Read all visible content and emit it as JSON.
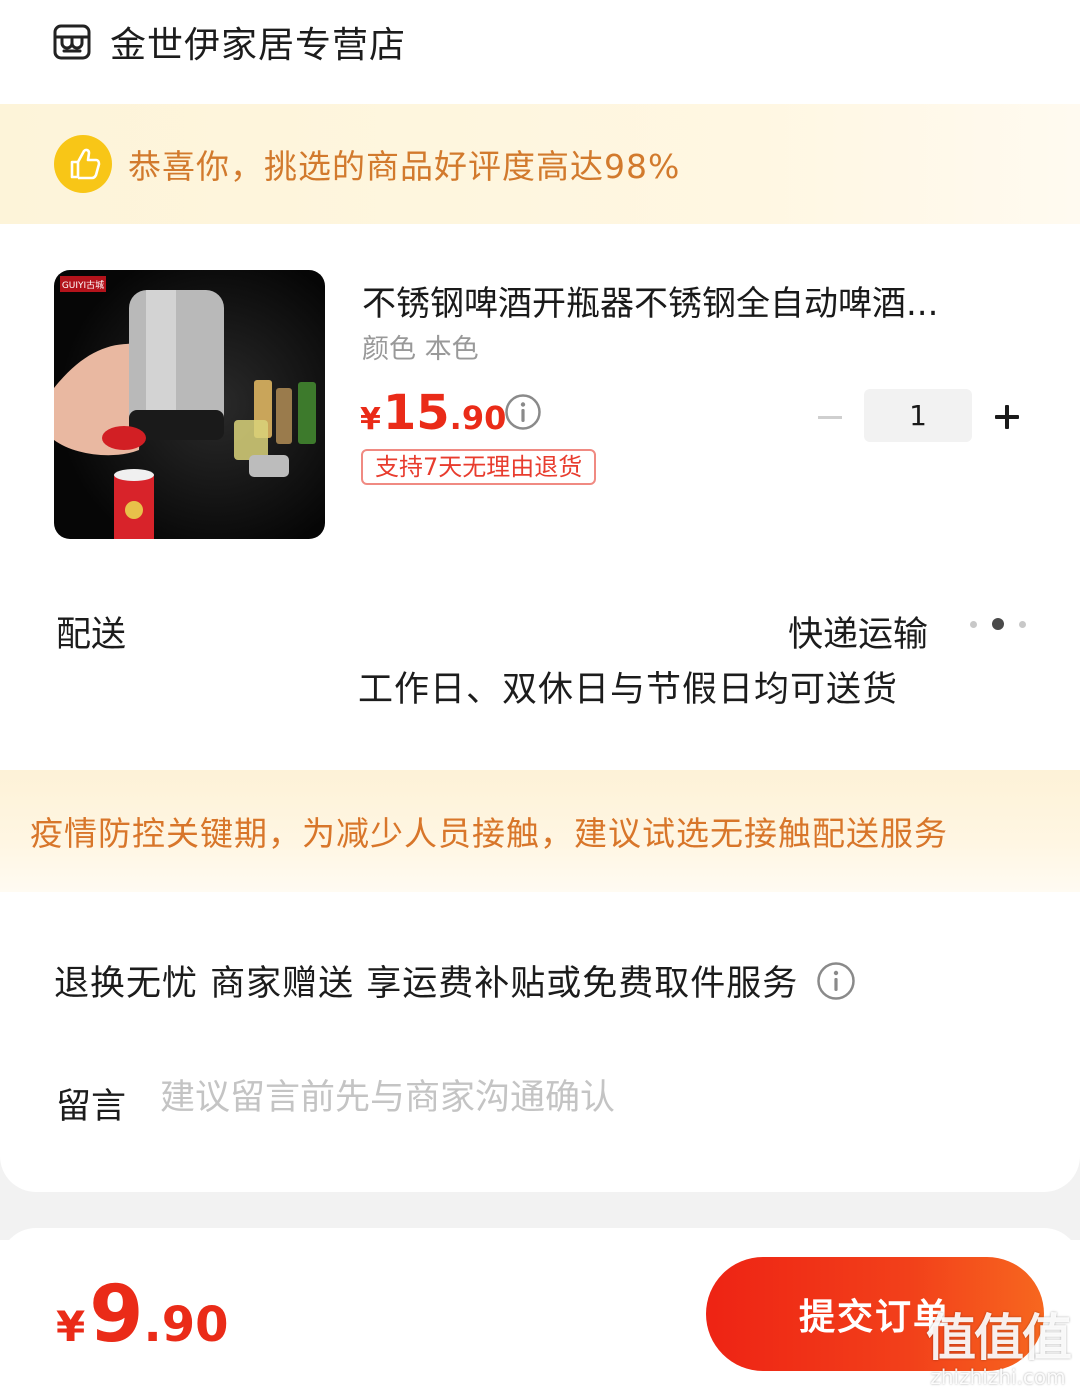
{
  "shop": {
    "name": "金世伊家居专营店",
    "icon": "store-icon"
  },
  "praise_banner": {
    "text": "恭喜你，挑选的商品好评度高达98%",
    "icon": "thumbs-up-icon",
    "color": "#d27a2d"
  },
  "product": {
    "image_label": "GUIYI古城",
    "title": "不锈钢啤酒开瓶器不锈钢全自动啤酒...",
    "spec": "颜色 本色",
    "price": {
      "currency": "¥",
      "integer": "15",
      "decimal": ".90"
    },
    "tag": "支持7天无理由退货",
    "quantity": "1"
  },
  "delivery": {
    "label": "配送",
    "method": "快递运输",
    "note": "工作日、双休日与节假日均可送货"
  },
  "covid_notice": {
    "text": "疫情防控关键期，为减少人员接触，建议试选无接触配送服务"
  },
  "returns": {
    "text": "退换无忧 商家赠送  享运费补贴或免费取件服务"
  },
  "message": {
    "label": "留言",
    "placeholder": "建议留言前先与商家沟通确认"
  },
  "footer": {
    "total": {
      "currency": "¥",
      "integer": "9",
      "decimal": ".90"
    },
    "submit_label": "提交订单",
    "accent_color": "#ea2b18"
  },
  "watermark": {
    "big": "值值值",
    "small": "zhizhizhi.com"
  }
}
